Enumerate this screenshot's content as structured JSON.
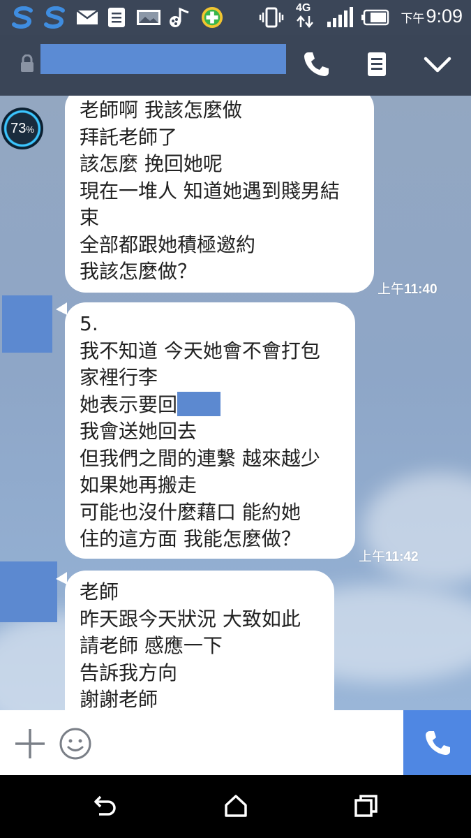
{
  "status_bar": {
    "time_period": "下午",
    "time": "9:09",
    "network": "4G",
    "icons": [
      "s-app-icon",
      "s-app-icon",
      "mail-icon",
      "document-icon",
      "image-icon",
      "music-icon",
      "game-icon",
      "vibrate-icon",
      "signal-icon",
      "battery-icon"
    ]
  },
  "header": {
    "title": "",
    "icons": [
      "lock-icon",
      "phone-icon",
      "notes-icon",
      "chevron-down-icon"
    ]
  },
  "overlay": {
    "battery_percent": "73",
    "percent_sign": "%"
  },
  "messages": [
    {
      "lines": [
        "老師啊 我該怎麼做",
        "拜託老師了",
        "該怎麼 挽回她呢",
        "現在一堆人 知道她遇到賤男結",
        "束",
        "全部都跟她積極邀約",
        "我該怎麼做？"
      ],
      "time_prefix": "上午",
      "time": "11:40"
    },
    {
      "lines": [
        "5.",
        "我不知道 今天她會不會打包",
        "家裡行李",
        "她表示要回",
        "我會送她回去",
        "但我們之間的連繫 越來越少",
        "如果她再搬走",
        "可能也沒什麼藉口 能約她",
        "住的這方面 我能怎麼做？"
      ],
      "time_prefix": "上午",
      "time": "11:42"
    },
    {
      "lines": [
        "老師",
        "昨天跟今天狀況 大致如此",
        "請老師 感應一下",
        "告訴我方向",
        "謝謝老師"
      ]
    }
  ],
  "input_bar": {
    "icons": [
      "plus-icon",
      "emoji-icon",
      "phone-icon"
    ]
  },
  "nav_bar": {
    "icons": [
      "back-icon",
      "home-icon",
      "recents-icon"
    ]
  }
}
